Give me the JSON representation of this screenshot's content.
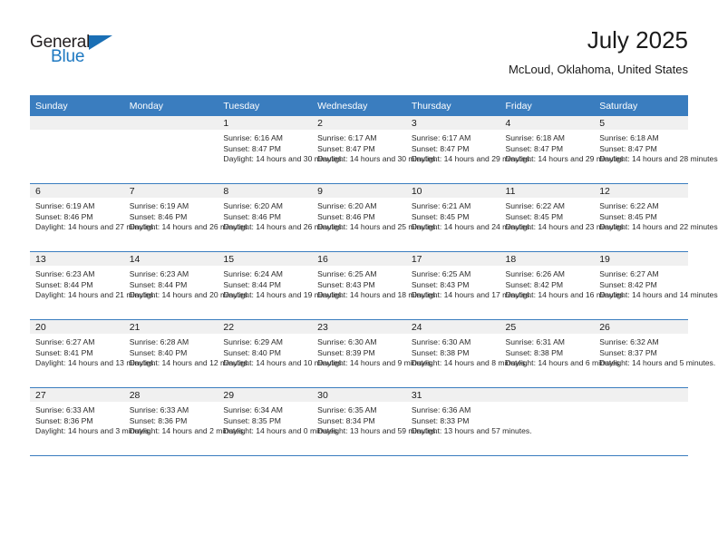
{
  "brand": {
    "name_top": "General",
    "name_bottom": "Blue",
    "triangle_icon": "triangle-logo-icon",
    "accent_color": "#1a6fb5"
  },
  "header": {
    "title": "July 2025",
    "location": "McLoud, Oklahoma, United States"
  },
  "theme": {
    "header_blue": "#3a7dbf",
    "daynum_band": "#f0f0f0",
    "text": "#2b2b2b"
  },
  "calendar": {
    "weekday_headers": [
      "Sunday",
      "Monday",
      "Tuesday",
      "Wednesday",
      "Thursday",
      "Friday",
      "Saturday"
    ],
    "leading_blanks": 2,
    "days": [
      {
        "day": "1",
        "sunrise": "Sunrise: 6:16 AM",
        "sunset": "Sunset: 8:47 PM",
        "daylight": "Daylight: 14 hours and 30 minutes."
      },
      {
        "day": "2",
        "sunrise": "Sunrise: 6:17 AM",
        "sunset": "Sunset: 8:47 PM",
        "daylight": "Daylight: 14 hours and 30 minutes."
      },
      {
        "day": "3",
        "sunrise": "Sunrise: 6:17 AM",
        "sunset": "Sunset: 8:47 PM",
        "daylight": "Daylight: 14 hours and 29 minutes."
      },
      {
        "day": "4",
        "sunrise": "Sunrise: 6:18 AM",
        "sunset": "Sunset: 8:47 PM",
        "daylight": "Daylight: 14 hours and 29 minutes."
      },
      {
        "day": "5",
        "sunrise": "Sunrise: 6:18 AM",
        "sunset": "Sunset: 8:47 PM",
        "daylight": "Daylight: 14 hours and 28 minutes."
      },
      {
        "day": "6",
        "sunrise": "Sunrise: 6:19 AM",
        "sunset": "Sunset: 8:46 PM",
        "daylight": "Daylight: 14 hours and 27 minutes."
      },
      {
        "day": "7",
        "sunrise": "Sunrise: 6:19 AM",
        "sunset": "Sunset: 8:46 PM",
        "daylight": "Daylight: 14 hours and 26 minutes."
      },
      {
        "day": "8",
        "sunrise": "Sunrise: 6:20 AM",
        "sunset": "Sunset: 8:46 PM",
        "daylight": "Daylight: 14 hours and 26 minutes."
      },
      {
        "day": "9",
        "sunrise": "Sunrise: 6:20 AM",
        "sunset": "Sunset: 8:46 PM",
        "daylight": "Daylight: 14 hours and 25 minutes."
      },
      {
        "day": "10",
        "sunrise": "Sunrise: 6:21 AM",
        "sunset": "Sunset: 8:45 PM",
        "daylight": "Daylight: 14 hours and 24 minutes."
      },
      {
        "day": "11",
        "sunrise": "Sunrise: 6:22 AM",
        "sunset": "Sunset: 8:45 PM",
        "daylight": "Daylight: 14 hours and 23 minutes."
      },
      {
        "day": "12",
        "sunrise": "Sunrise: 6:22 AM",
        "sunset": "Sunset: 8:45 PM",
        "daylight": "Daylight: 14 hours and 22 minutes."
      },
      {
        "day": "13",
        "sunrise": "Sunrise: 6:23 AM",
        "sunset": "Sunset: 8:44 PM",
        "daylight": "Daylight: 14 hours and 21 minutes."
      },
      {
        "day": "14",
        "sunrise": "Sunrise: 6:23 AM",
        "sunset": "Sunset: 8:44 PM",
        "daylight": "Daylight: 14 hours and 20 minutes."
      },
      {
        "day": "15",
        "sunrise": "Sunrise: 6:24 AM",
        "sunset": "Sunset: 8:44 PM",
        "daylight": "Daylight: 14 hours and 19 minutes."
      },
      {
        "day": "16",
        "sunrise": "Sunrise: 6:25 AM",
        "sunset": "Sunset: 8:43 PM",
        "daylight": "Daylight: 14 hours and 18 minutes."
      },
      {
        "day": "17",
        "sunrise": "Sunrise: 6:25 AM",
        "sunset": "Sunset: 8:43 PM",
        "daylight": "Daylight: 14 hours and 17 minutes."
      },
      {
        "day": "18",
        "sunrise": "Sunrise: 6:26 AM",
        "sunset": "Sunset: 8:42 PM",
        "daylight": "Daylight: 14 hours and 16 minutes."
      },
      {
        "day": "19",
        "sunrise": "Sunrise: 6:27 AM",
        "sunset": "Sunset: 8:42 PM",
        "daylight": "Daylight: 14 hours and 14 minutes."
      },
      {
        "day": "20",
        "sunrise": "Sunrise: 6:27 AM",
        "sunset": "Sunset: 8:41 PM",
        "daylight": "Daylight: 14 hours and 13 minutes."
      },
      {
        "day": "21",
        "sunrise": "Sunrise: 6:28 AM",
        "sunset": "Sunset: 8:40 PM",
        "daylight": "Daylight: 14 hours and 12 minutes."
      },
      {
        "day": "22",
        "sunrise": "Sunrise: 6:29 AM",
        "sunset": "Sunset: 8:40 PM",
        "daylight": "Daylight: 14 hours and 10 minutes."
      },
      {
        "day": "23",
        "sunrise": "Sunrise: 6:30 AM",
        "sunset": "Sunset: 8:39 PM",
        "daylight": "Daylight: 14 hours and 9 minutes."
      },
      {
        "day": "24",
        "sunrise": "Sunrise: 6:30 AM",
        "sunset": "Sunset: 8:38 PM",
        "daylight": "Daylight: 14 hours and 8 minutes."
      },
      {
        "day": "25",
        "sunrise": "Sunrise: 6:31 AM",
        "sunset": "Sunset: 8:38 PM",
        "daylight": "Daylight: 14 hours and 6 minutes."
      },
      {
        "day": "26",
        "sunrise": "Sunrise: 6:32 AM",
        "sunset": "Sunset: 8:37 PM",
        "daylight": "Daylight: 14 hours and 5 minutes."
      },
      {
        "day": "27",
        "sunrise": "Sunrise: 6:33 AM",
        "sunset": "Sunset: 8:36 PM",
        "daylight": "Daylight: 14 hours and 3 minutes."
      },
      {
        "day": "28",
        "sunrise": "Sunrise: 6:33 AM",
        "sunset": "Sunset: 8:36 PM",
        "daylight": "Daylight: 14 hours and 2 minutes."
      },
      {
        "day": "29",
        "sunrise": "Sunrise: 6:34 AM",
        "sunset": "Sunset: 8:35 PM",
        "daylight": "Daylight: 14 hours and 0 minutes."
      },
      {
        "day": "30",
        "sunrise": "Sunrise: 6:35 AM",
        "sunset": "Sunset: 8:34 PM",
        "daylight": "Daylight: 13 hours and 59 minutes."
      },
      {
        "day": "31",
        "sunrise": "Sunrise: 6:36 AM",
        "sunset": "Sunset: 8:33 PM",
        "daylight": "Daylight: 13 hours and 57 minutes."
      }
    ]
  }
}
